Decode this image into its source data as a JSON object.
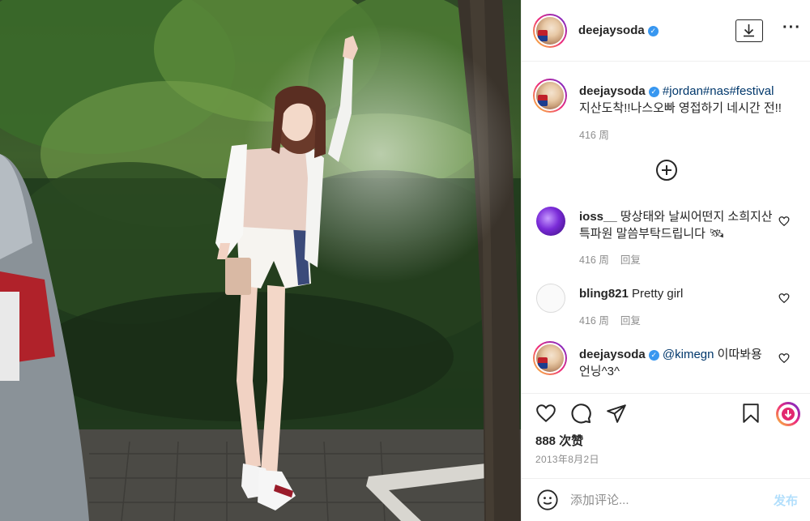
{
  "post": {
    "username": "deejaysoda",
    "caption": {
      "username": "deejaysoda",
      "hashtags": "#jordan#nas#festival",
      "text": "지산도착!!나스오빠 영접하기 네시간 전!!",
      "time": "416 周"
    },
    "comments": [
      {
        "username": "ioss__",
        "text_line1": "땅상태와 날씨어떤지 소희지산",
        "text_line2": "특파원 말씀부탁드립니다 🛰",
        "time": "416 周",
        "reply": "回复"
      },
      {
        "username": "bling821",
        "text": "Pretty girl",
        "time": "416 周",
        "reply": "回复"
      },
      {
        "username": "deejaysoda",
        "mention": "@kimegn",
        "text_line1": "이따봐용",
        "text_line2": "언닝^3^"
      }
    ],
    "likes": "888 次赞",
    "date": "2013年8月2日",
    "add_comment_placeholder": "添加评论...",
    "post_button": "发布"
  },
  "icons": {
    "download": "download-icon",
    "more": "more-options-icon",
    "like": "heart-icon",
    "comment": "comment-icon",
    "share": "send-icon",
    "save": "bookmark-icon",
    "emoji": "emoji-icon",
    "load_more": "plus-circle-icon"
  },
  "colors": {
    "link": "#00376b",
    "verified": "#3897f0",
    "muted": "#8e8e8e",
    "post_button": "#b2dffc"
  }
}
